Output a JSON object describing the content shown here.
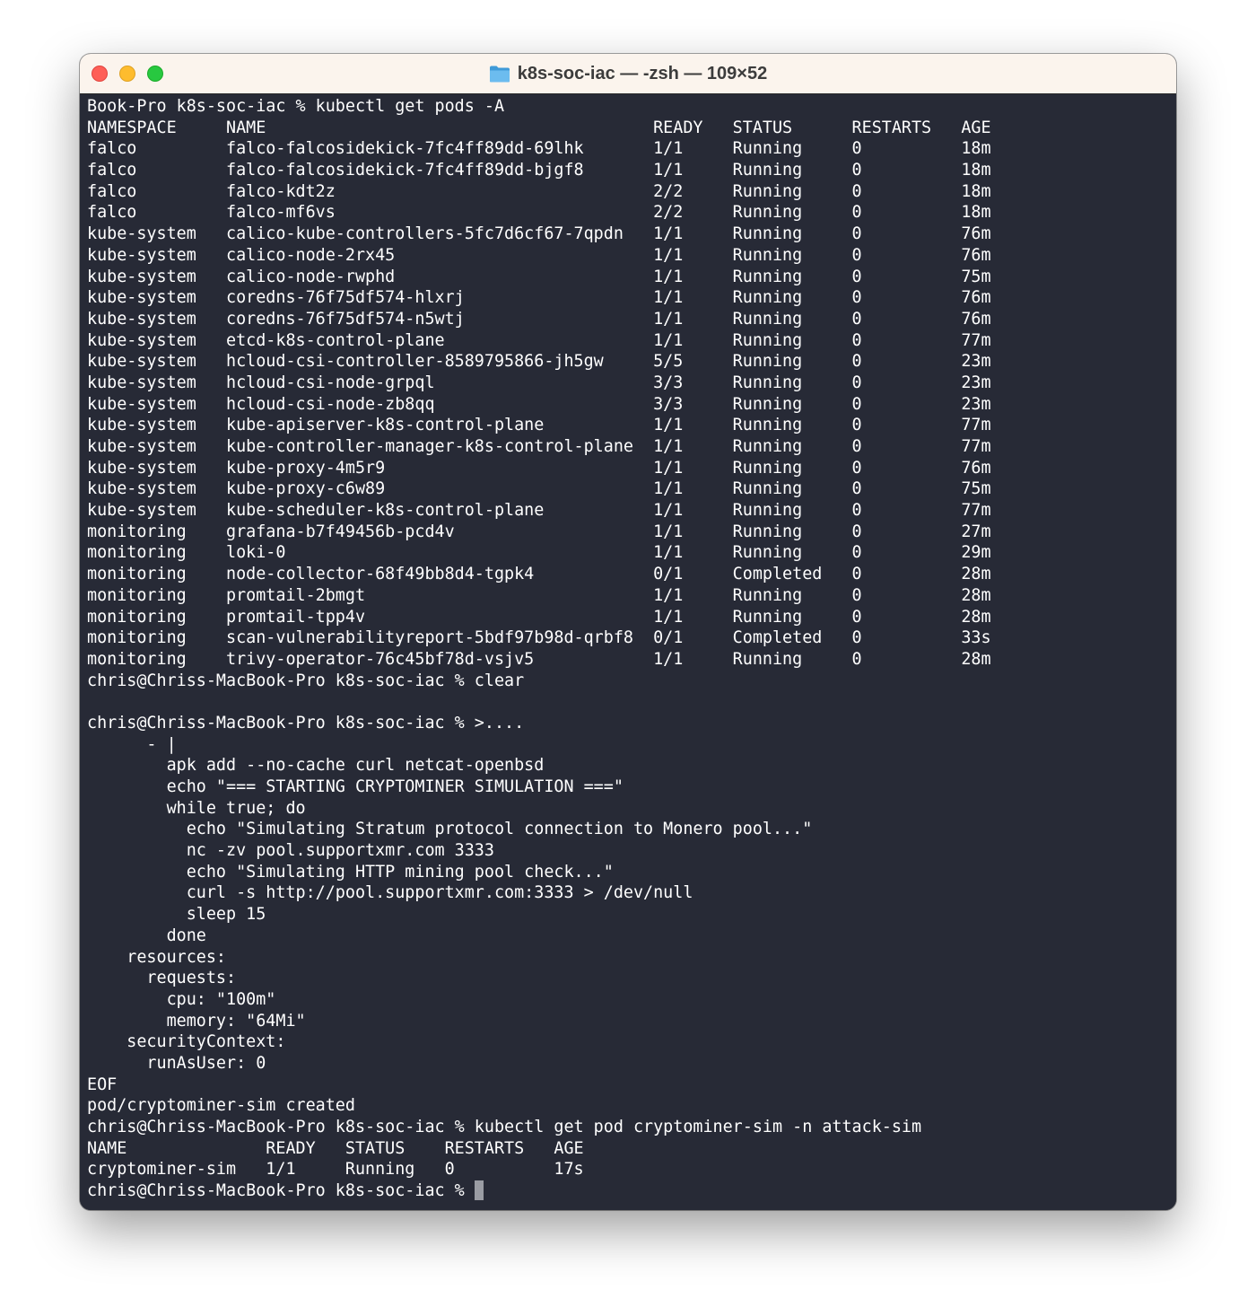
{
  "window": {
    "title": "k8s-soc-iac — -zsh — 109×52",
    "colors": {
      "titlebar_bg": "#fbf4ed",
      "terminal_bg": "#272a36",
      "terminal_fg": "#ffffff",
      "close": "#fe5f57",
      "minimize": "#febc2e",
      "maximize": "#28c840",
      "folder_icon": "#5aafe6"
    }
  },
  "terminal": {
    "lines": [
      "Book-Pro k8s-soc-iac % kubectl get pods -A",
      "NAMESPACE     NAME                                       READY   STATUS      RESTARTS   AGE",
      "falco         falco-falcosidekick-7fc4ff89dd-69lhk       1/1     Running     0          18m",
      "falco         falco-falcosidekick-7fc4ff89dd-bjgf8       1/1     Running     0          18m",
      "falco         falco-kdt2z                                2/2     Running     0          18m",
      "falco         falco-mf6vs                                2/2     Running     0          18m",
      "kube-system   calico-kube-controllers-5fc7d6cf67-7qpdn   1/1     Running     0          76m",
      "kube-system   calico-node-2rx45                          1/1     Running     0          76m",
      "kube-system   calico-node-rwphd                          1/1     Running     0          75m",
      "kube-system   coredns-76f75df574-hlxrj                   1/1     Running     0          76m",
      "kube-system   coredns-76f75df574-n5wtj                   1/1     Running     0          76m",
      "kube-system   etcd-k8s-control-plane                     1/1     Running     0          77m",
      "kube-system   hcloud-csi-controller-8589795866-jh5gw     5/5     Running     0          23m",
      "kube-system   hcloud-csi-node-grpql                      3/3     Running     0          23m",
      "kube-system   hcloud-csi-node-zb8qq                      3/3     Running     0          23m",
      "kube-system   kube-apiserver-k8s-control-plane           1/1     Running     0          77m",
      "kube-system   kube-controller-manager-k8s-control-plane  1/1     Running     0          77m",
      "kube-system   kube-proxy-4m5r9                           1/1     Running     0          76m",
      "kube-system   kube-proxy-c6w89                           1/1     Running     0          75m",
      "kube-system   kube-scheduler-k8s-control-plane           1/1     Running     0          77m",
      "monitoring    grafana-b7f49456b-pcd4v                    1/1     Running     0          27m",
      "monitoring    loki-0                                     1/1     Running     0          29m",
      "monitoring    node-collector-68f49bb8d4-tgpk4            0/1     Completed   0          28m",
      "monitoring    promtail-2bmgt                             1/1     Running     0          28m",
      "monitoring    promtail-tpp4v                             1/1     Running     0          28m",
      "monitoring    scan-vulnerabilityreport-5bdf97b98d-qrbf8  0/1     Completed   0          33s",
      "monitoring    trivy-operator-76c45bf78d-vsjv5            1/1     Running     0          28m",
      "chris@Chriss-MacBook-Pro k8s-soc-iac % clear",
      "",
      "chris@Chriss-MacBook-Pro k8s-soc-iac % >....",
      "      - |",
      "        apk add --no-cache curl netcat-openbsd",
      "        echo \"=== STARTING CRYPTOMINER SIMULATION ===\"",
      "        while true; do",
      "          echo \"Simulating Stratum protocol connection to Monero pool...\"",
      "          nc -zv pool.supportxmr.com 3333",
      "          echo \"Simulating HTTP mining pool check...\"",
      "          curl -s http://pool.supportxmr.com:3333 > /dev/null",
      "          sleep 15",
      "        done",
      "    resources:",
      "      requests:",
      "        cpu: \"100m\"",
      "        memory: \"64Mi\"",
      "    securityContext:",
      "      runAsUser: 0",
      "EOF",
      "pod/cryptominer-sim created",
      "chris@Chriss-MacBook-Pro k8s-soc-iac % kubectl get pod cryptominer-sim -n attack-sim",
      "NAME              READY   STATUS    RESTARTS   AGE",
      "cryptominer-sim   1/1     Running   0          17s"
    ],
    "prompt": "chris@Chriss-MacBook-Pro k8s-soc-iac % "
  }
}
